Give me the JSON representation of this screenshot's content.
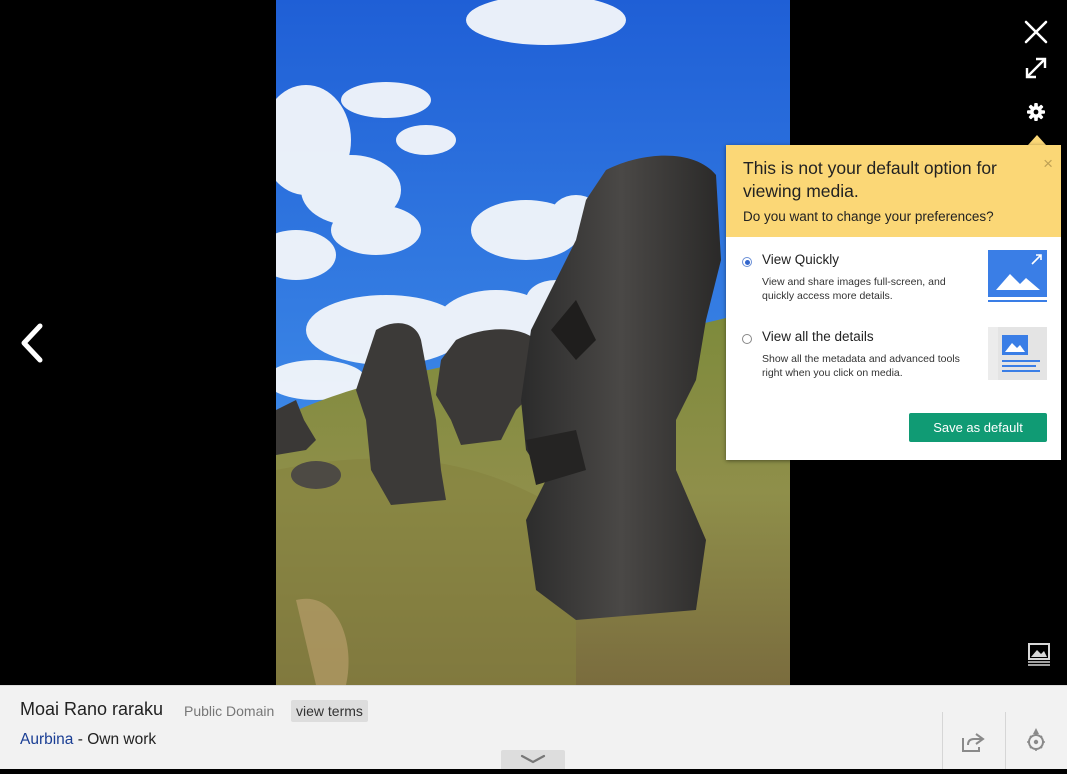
{
  "viewer": {
    "icons": {
      "close": "close-icon",
      "expand": "expand-icon",
      "settings": "gear-icon",
      "previous": "chevron-left-icon",
      "gallery": "gallery-icon"
    }
  },
  "popup": {
    "title": "This is not your default option for viewing media.",
    "question": "Do you want to change your preferences?",
    "close_label": "×",
    "options": [
      {
        "title": "View Quickly",
        "description": "View and share images full-screen, and quickly access more details.",
        "selected": true
      },
      {
        "title": "View all the details",
        "description": "Show all the metadata and advanced tools right when you click on media.",
        "selected": false
      }
    ],
    "save_label": "Save as default",
    "colors": {
      "header": "#fbd776",
      "button": "#109b74",
      "accent": "#3366cc"
    }
  },
  "info": {
    "title": "Moai Rano raraku",
    "license": "Public Domain",
    "terms_label": "view terms",
    "author": "Aurbina",
    "source_suffix": " - Own work",
    "icons": {
      "share": "share-icon",
      "commons": "commons-logo-icon",
      "expand": "chevron-down-icon"
    }
  }
}
